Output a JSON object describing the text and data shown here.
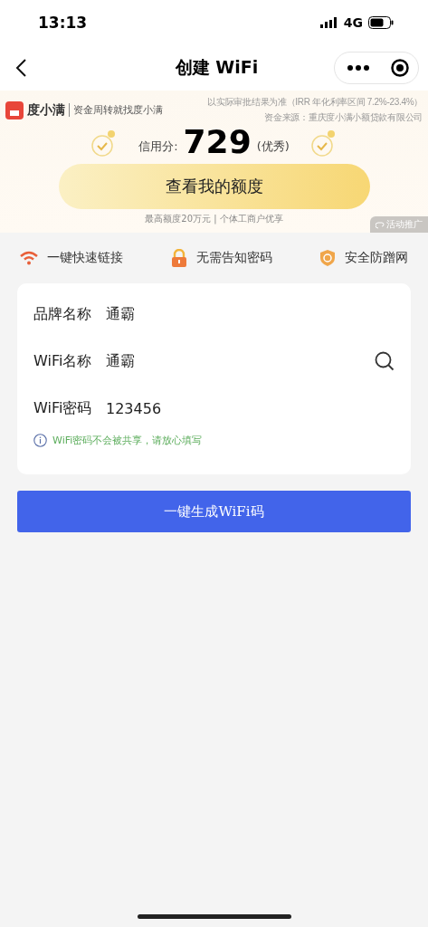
{
  "status_bar": {
    "time": "13:13",
    "network": "4G"
  },
  "nav": {
    "title": "创建 WiFi"
  },
  "ad": {
    "brand": "度小满",
    "tagline": "资金周转就找度小满",
    "disclaimer": [
      "以实际审批结果为准（IRR 年化利率区间 7.2%-23.4%）",
      "资金来源：重庆度小满小额贷款有限公司"
    ],
    "score_label": "信用分:",
    "score": "729",
    "score_grade": "(优秀)",
    "button": "查看我的额度",
    "note": "最高额度20万元 | 个体工商户优享",
    "badge": "活动推广"
  },
  "features": [
    {
      "kind": "wifi",
      "label": "一键快速链接"
    },
    {
      "kind": "lock",
      "label": "无需告知密码"
    },
    {
      "kind": "shield",
      "label": "安全防蹭网"
    }
  ],
  "form": {
    "fields": [
      {
        "label": "品牌名称",
        "value": "通霸",
        "kind": "plain"
      },
      {
        "label": "WiFi名称",
        "value": "通霸",
        "kind": "search"
      },
      {
        "label": "WiFi密码",
        "value": "123456",
        "kind": "plain"
      }
    ],
    "hint": "WiFi密码不会被共享，请放心填写"
  },
  "submit": "一键生成WiFi码"
}
